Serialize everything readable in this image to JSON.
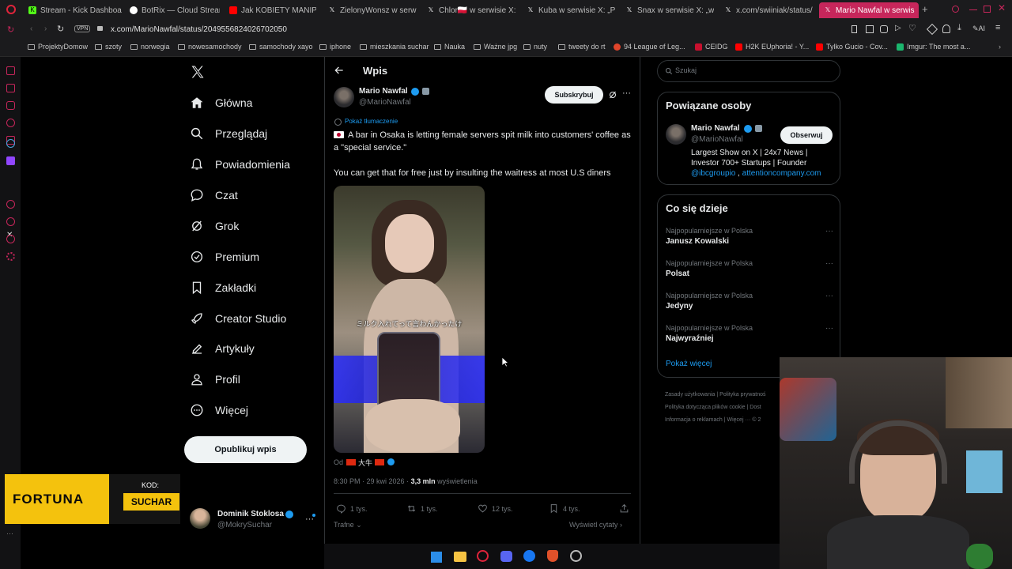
{
  "browser": {
    "tabs": [
      {
        "label": "Stream - Kick Dashboard",
        "color": "#53fc18"
      },
      {
        "label": "BotRix — Cloud Streaming",
        "color": "#ffffff"
      },
      {
        "label": "Jak KOBIETY MANIPULU...",
        "color": "#ff0000"
      },
      {
        "label": "ZielonyWonsz w serwisie",
        "color": "#ffffff"
      },
      {
        "label": "Chlor🇵🇱 w serwisie X: „",
        "color": "#ffffff"
      },
      {
        "label": "Kuba w serwisie X: „Pasu",
        "color": "#ffffff"
      },
      {
        "label": "Snax w serwisie X: „waa",
        "color": "#ffffff"
      },
      {
        "label": "x.com/swiiniak/status/20",
        "color": "#ffffff"
      },
      {
        "label": "Mario Nawfal w serwis",
        "color": "#ffffff"
      }
    ],
    "url": "x.com/MarioNawfal/status/2049556824026702050",
    "vpn_label": "VPN",
    "bookmarks": [
      {
        "label": "ProjektyDomow",
        "kind": "folder"
      },
      {
        "label": "szoty",
        "kind": "folder"
      },
      {
        "label": "norwegia",
        "kind": "folder"
      },
      {
        "label": "nowesamochody",
        "kind": "folder"
      },
      {
        "label": "samochody xayo",
        "kind": "folder"
      },
      {
        "label": "iphone",
        "kind": "folder"
      },
      {
        "label": "mieszkania suchar",
        "kind": "folder"
      },
      {
        "label": "Nauka",
        "kind": "folder"
      },
      {
        "label": "Ważne jpg",
        "kind": "folder"
      },
      {
        "label": "nuty",
        "kind": "folder"
      },
      {
        "label": "tweety do rt",
        "kind": "folder"
      },
      {
        "label": "94 League of Leg...",
        "kind": "site",
        "color": "#e0452b"
      },
      {
        "label": "CEIDG",
        "kind": "site",
        "color": "#c8102e"
      },
      {
        "label": "H2K EUphoria! - Y...",
        "kind": "site",
        "color": "#ff0000"
      },
      {
        "label": "Tylko Gucio - Cov...",
        "kind": "site",
        "color": "#ff0000"
      },
      {
        "label": "Imgur: The most a...",
        "kind": "site",
        "color": "#1bb76e"
      }
    ]
  },
  "nav": {
    "items": [
      {
        "label": "Główna",
        "icon": "home-icon"
      },
      {
        "label": "Przeglądaj",
        "icon": "search-icon"
      },
      {
        "label": "Powiadomienia",
        "icon": "bell-icon"
      },
      {
        "label": "Czat",
        "icon": "chat-icon"
      },
      {
        "label": "Grok",
        "icon": "grok-icon"
      },
      {
        "label": "Premium",
        "icon": "premium-icon"
      },
      {
        "label": "Zakładki",
        "icon": "bookmark-icon"
      },
      {
        "label": "Creator Studio",
        "icon": "rocket-icon"
      },
      {
        "label": "Artykuły",
        "icon": "article-icon"
      },
      {
        "label": "Profil",
        "icon": "profile-icon"
      },
      {
        "label": "Więcej",
        "icon": "more-icon"
      }
    ],
    "post_button": "Opublikuj wpis",
    "account": {
      "name": "Dominik Stoklosa",
      "handle": "@MokrySuchar"
    }
  },
  "post": {
    "header_title": "Wpis",
    "author": {
      "name": "Mario Nawfal",
      "handle": "@MarioNawfal"
    },
    "subscribe_label": "Subskrybuj",
    "translate_label": "Pokaż tłumaczenie",
    "text_line1": "A bar in Osaka is letting female servers spit milk into customers' coffee as a \"special service.\"",
    "text_line2": "You can get that for free just by insulting the waitress at most U.S diners",
    "video_caption": "ミルク入れてって言わんかったけ",
    "source_label": "Od",
    "source_name": "大牛",
    "timestamp": "8:30 PM · 29 kwi 2026 ·",
    "views_value": "3,3 mln",
    "views_label": "wyświetlenia",
    "replies": "1 tys.",
    "reposts": "1 tys.",
    "likes": "12 tys.",
    "bookmarks": "4 tys.",
    "sort_label": "Trafne",
    "quotes_label": "Wyświetl cytaty"
  },
  "sidebar": {
    "search_placeholder": "Szukaj",
    "related_title": "Powiązane osoby",
    "related": {
      "name": "Mario Nawfal",
      "handle": "@MarioNawfal",
      "follow_label": "Obserwuj",
      "bio_line1": "Largest Show on X | 24x7 News |",
      "bio_line2": "Investor 700+ Startups | Founder",
      "bio_link1": "@ibcgroupio",
      "bio_sep": ",",
      "bio_link2": "attentioncompany.com"
    },
    "trends_title": "Co się dzieje",
    "trends": [
      {
        "context": "Najpopularniejsze w Polska",
        "name": "Janusz Kowalski"
      },
      {
        "context": "Najpopularniejsze w Polska",
        "name": "Polsat"
      },
      {
        "context": "Najpopularniejsze w Polska",
        "name": "Jedyny"
      },
      {
        "context": "Najpopularniejsze w Polska",
        "name": "Najwyraźniej"
      }
    ],
    "show_more": "Pokaż więcej",
    "footer_line1": [
      "Zasady użytkowania",
      "|",
      "Polityka prywatnoś"
    ],
    "footer_line2": [
      "Polityka dotycząca plików cookie",
      "|",
      "Dost"
    ],
    "footer_line3": [
      "Informacja o reklamach",
      "|",
      "Więcej ···",
      "© 2"
    ]
  },
  "overlay": {
    "sponsor_name": "FORTUNA",
    "code_label": "KOD:",
    "code_value": "SUCHAR"
  },
  "colors": {
    "accent": "#1d9bf0",
    "tab_active": "#c7265b",
    "fortuna": "#f4c20d"
  }
}
